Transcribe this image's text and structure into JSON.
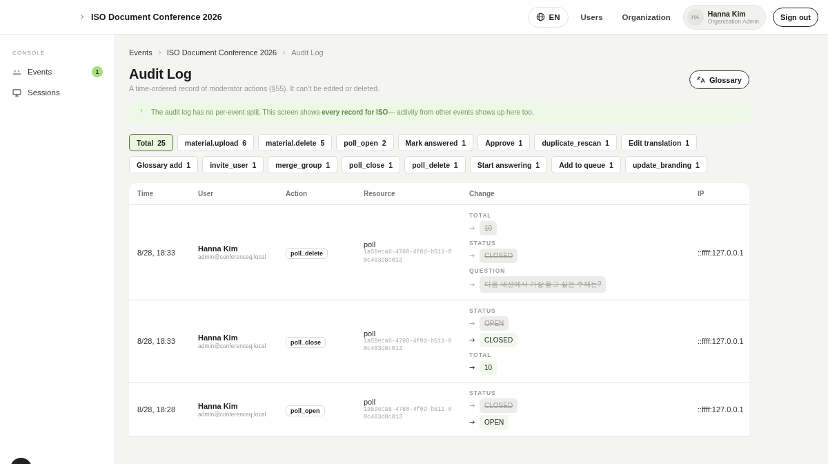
{
  "topbar": {
    "title": "ISO Document Conference 2026",
    "language": "EN",
    "links": [
      "Users",
      "Organization"
    ],
    "user": {
      "initials": "HA",
      "name": "Hanna Kim",
      "role": "Organization Admin"
    },
    "sign_out": "Sign out"
  },
  "sidebar": {
    "section": "CONSOLE",
    "items": [
      {
        "label": "Events",
        "kind": "events",
        "badge": "1"
      },
      {
        "label": "Sessions",
        "kind": "sessions"
      }
    ]
  },
  "breadcrumb": [
    "Events",
    "ISO Document Conference 2026",
    "Audit Log"
  ],
  "page": {
    "title": "Audit Log",
    "subtitle": "A time-ordered record of moderator actions (§55). It can’t be edited or deleted.",
    "glossary_button": "Glossary"
  },
  "notice": "The audit log has no per-event split. This screen shows **every record for ISO**— activity from other events shows up here too.",
  "filter_rows": [
    [
      {
        "label": "Total",
        "count": "25",
        "selected": true
      },
      {
        "label": "material.upload",
        "count": "6",
        "selected": false
      },
      {
        "label": "material.delete",
        "count": "5",
        "selected": false
      },
      {
        "label": "poll_open",
        "count": "2",
        "selected": false
      },
      {
        "label": "Mark answered",
        "count": "1",
        "selected": false
      },
      {
        "label": "Approve",
        "count": "1",
        "selected": false
      },
      {
        "label": "duplicate_rescan",
        "count": "1",
        "selected": false
      },
      {
        "label": "Edit translation",
        "count": "1",
        "selected": false
      }
    ],
    [
      {
        "label": "Glossary add",
        "count": "1",
        "selected": false
      },
      {
        "label": "invite_user",
        "count": "1",
        "selected": false
      },
      {
        "label": "merge_group",
        "count": "1",
        "selected": false
      },
      {
        "label": "poll_close",
        "count": "1",
        "selected": false
      },
      {
        "label": "poll_delete",
        "count": "1",
        "selected": false
      },
      {
        "label": "Start answering",
        "count": "1",
        "selected": false
      },
      {
        "label": "Add to queue",
        "count": "1",
        "selected": false
      },
      {
        "label": "update_branding",
        "count": "1",
        "selected": false
      }
    ]
  ],
  "table": {
    "columns": [
      "Time",
      "User",
      "Action",
      "Resource",
      "Change",
      "IP"
    ],
    "rows": [
      {
        "time": "8/28, 18:33",
        "user": "Hanna Kim",
        "email": "admin@conferenceq.local",
        "action": "poll_delete",
        "resource": "poll",
        "resource_id": "1a59eca8-4780-4f0d-b511-00c483d8c013",
        "ip": "::ffff:127.0.0.1",
        "changes": [
          {
            "field": "TOTAL",
            "values": [
              {
                "text": "10",
                "removed": true
              }
            ]
          },
          {
            "field": "STATUS",
            "values": [
              {
                "text": "CLOSED",
                "removed": true
              }
            ]
          },
          {
            "field": "QUESTION",
            "values": [
              {
                "text": "다음 세션에서 가장 듣고 싶은 주제는?",
                "removed": true
              }
            ]
          }
        ]
      },
      {
        "time": "8/28, 18:33",
        "user": "Hanna Kim",
        "email": "admin@conferenceq.local",
        "action": "poll_close",
        "resource": "poll",
        "resource_id": "1a59eca8-4780-4f0d-b511-00c483d8c013",
        "ip": "::ffff:127.0.0.1",
        "changes": [
          {
            "field": "STATUS",
            "values": [
              {
                "text": "OPEN",
                "removed": true
              },
              {
                "text": "CLOSED",
                "removed": false
              }
            ]
          },
          {
            "field": "TOTAL",
            "values": [
              {
                "text": "10",
                "removed": false
              }
            ]
          }
        ]
      },
      {
        "time": "8/28, 18:28",
        "user": "Hanna Kim",
        "email": "admin@conferenceq.local",
        "action": "poll_open",
        "resource": "poll",
        "resource_id": "1a59eca8-4780-4f0d-b511-00c483d8c013",
        "ip": "::ffff:127.0.0.1",
        "changes": [
          {
            "field": "STATUS",
            "values": [
              {
                "text": "CLOSED",
                "removed": true
              },
              {
                "text": "OPEN",
                "removed": false
              }
            ]
          }
        ]
      }
    ]
  }
}
